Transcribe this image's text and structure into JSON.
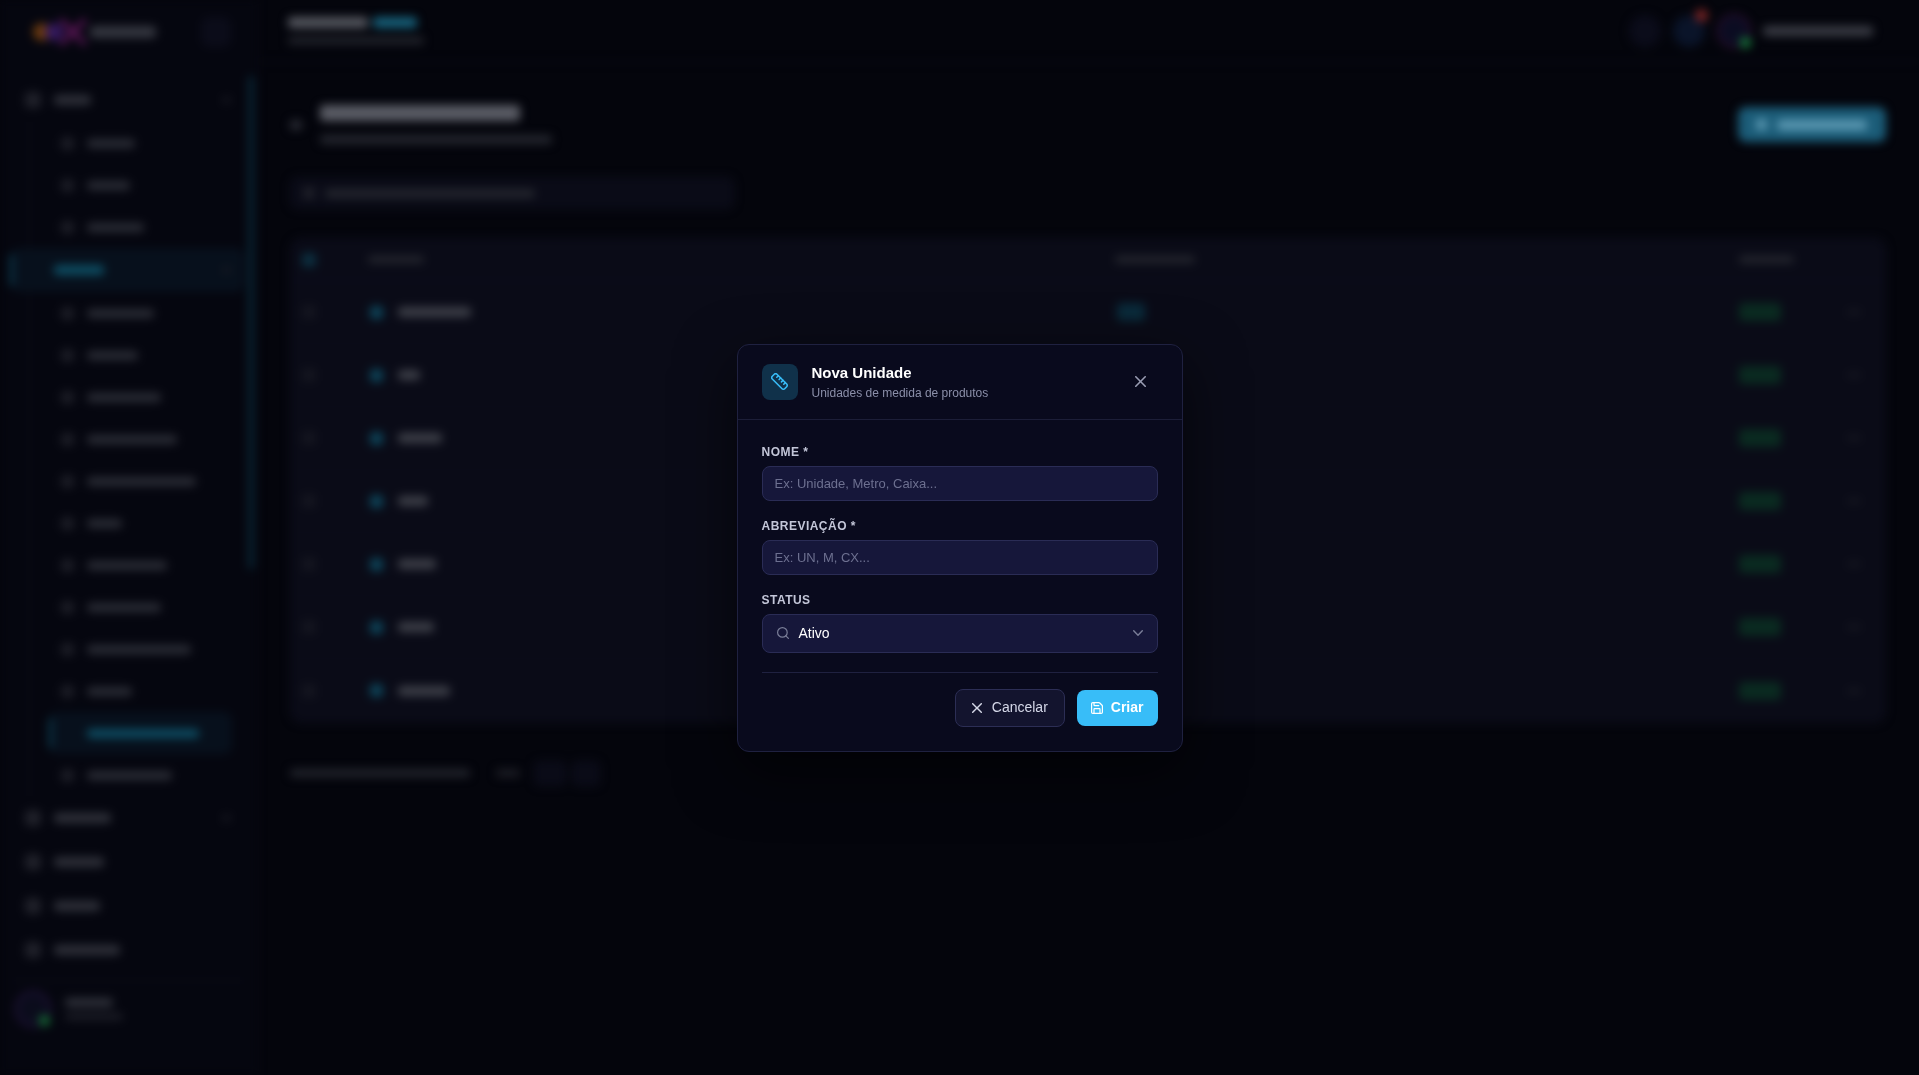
{
  "modal": {
    "title": "Nova Unidade",
    "subtitle": "Unidades de medida de produtos",
    "fields": [
      {
        "kind": "text",
        "label": "NOME *",
        "placeholder": "Ex: Unidade, Metro, Caixa..."
      },
      {
        "kind": "text",
        "label": "ABREVIAÇÃO *",
        "placeholder": "Ex: UN, M, CX..."
      },
      {
        "kind": "select",
        "label": "STATUS",
        "value": "Ativo"
      }
    ],
    "buttons": [
      {
        "kind": "secondary",
        "label": "Cancelar"
      },
      {
        "kind": "primary",
        "label": "Criar"
      }
    ]
  }
}
